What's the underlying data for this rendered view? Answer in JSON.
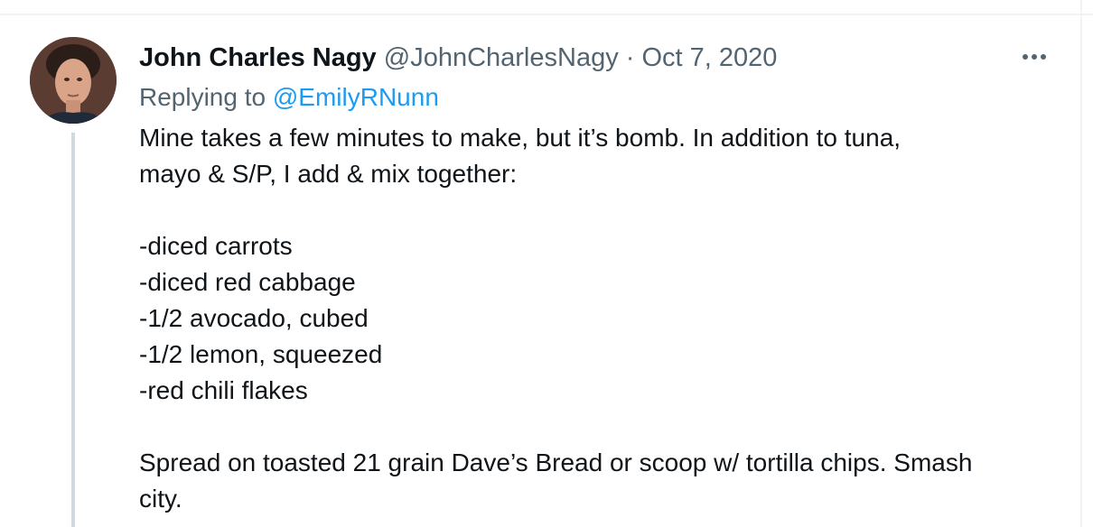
{
  "tweet": {
    "display_name": "John Charles Nagy",
    "handle": "@JohnCharlesNagy",
    "separator": "·",
    "date": "Oct 7, 2020",
    "more_icon": "ellipsis-icon",
    "replying_prefix": "Replying to",
    "replying_to": "@EmilyRNunn",
    "lines": [
      "Mine takes a few minutes to make, but it’s bomb. In addition to tuna,",
      "mayo & S/P, I add & mix together:",
      "",
      "-diced carrots",
      "-diced red cabbage",
      "-1/2 avocado, cubed",
      "-1/2 lemon, squeezed",
      "-red chili flakes",
      "",
      "Spread on toasted 21 grain Dave’s Bread or scoop w/ tortilla chips. Smash",
      "city."
    ]
  },
  "colors": {
    "text_primary": "#0f1419",
    "text_secondary": "#536471",
    "link": "#1d9bf0",
    "thread_line": "#cfd9de"
  }
}
